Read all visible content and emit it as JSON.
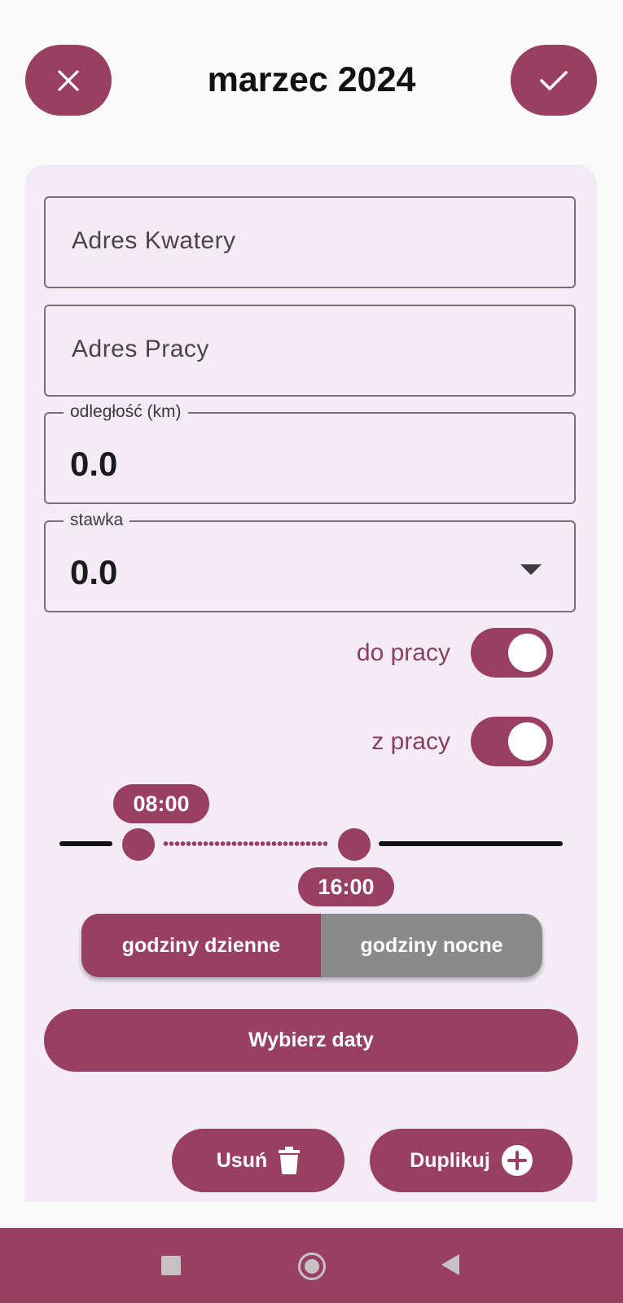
{
  "header": {
    "title": "marzec 2024"
  },
  "fields": {
    "adres_kwatery": {
      "placeholder": "Adres Kwatery"
    },
    "adres_pracy": {
      "placeholder": "Adres Pracy"
    },
    "odleglosc": {
      "label": "odległość (km)",
      "value": "0.0"
    },
    "stawka": {
      "label": "stawka",
      "value": "0.0"
    }
  },
  "toggles": {
    "do_pracy": {
      "label": "do pracy",
      "on": true
    },
    "z_pracy": {
      "label": "z pracy",
      "on": true
    }
  },
  "time_range": {
    "start": "08:00",
    "end": "16:00"
  },
  "hours_toggle": {
    "day": "godziny dzienne",
    "night": "godziny nocne",
    "selected": "day"
  },
  "actions": {
    "choose_dates": "Wybierz daty",
    "delete": "Usuń",
    "duplicate": "Duplikuj"
  },
  "colors": {
    "accent": "#993f62",
    "panel": "#f3ecf7",
    "inactive_segment": "#8a8a8a"
  },
  "icons": [
    "close-icon",
    "check-icon",
    "dropdown-caret-icon",
    "trash-icon",
    "plus-circle-icon",
    "nav-square-icon",
    "nav-circle-icon",
    "nav-back-icon"
  ]
}
